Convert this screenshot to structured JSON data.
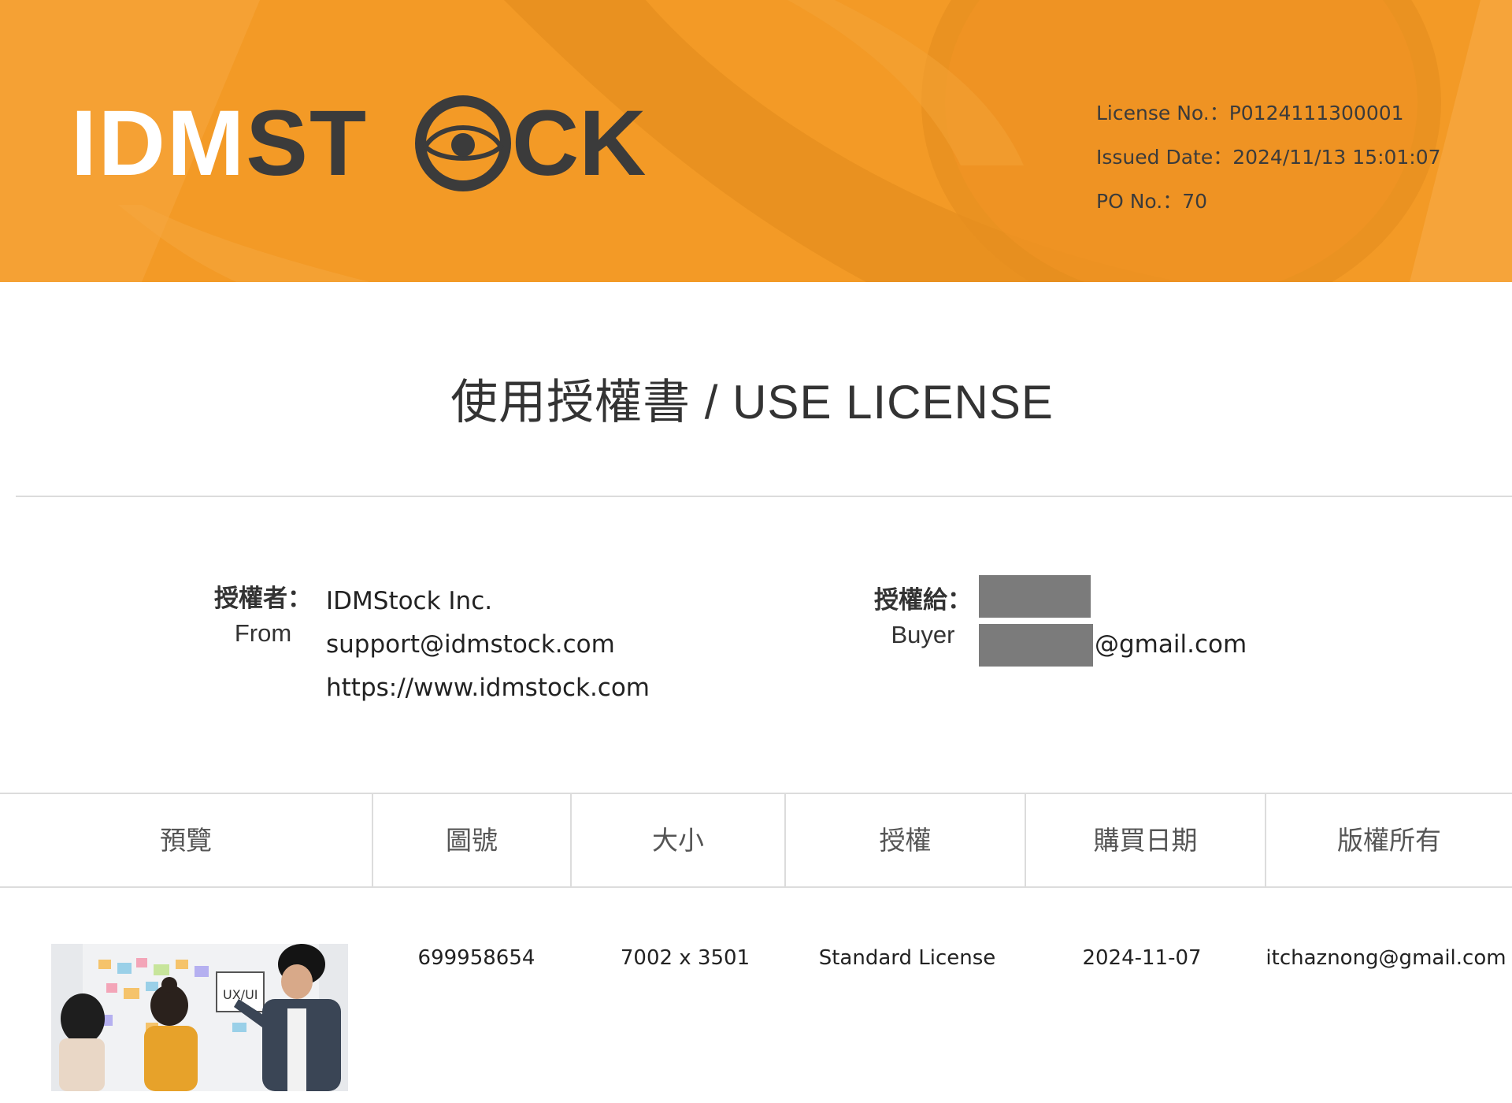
{
  "brand": {
    "logo_text": "IDMSTOCK",
    "colors": {
      "primary": "#f39a26",
      "dark": "#3b3b3b"
    }
  },
  "license_meta": {
    "license_no": "License No.：P0124111300001",
    "issued_date": "Issued Date：2024/11/13 15:01:07",
    "po_no": "PO No.：70"
  },
  "title": "使用授權書 / USE LICENSE",
  "from": {
    "label_zh": "授權者：",
    "label_en": "From",
    "company": "IDMStock Inc.",
    "email": "support@idmstock.com",
    "website": "https://www.idmstock.com"
  },
  "buyer": {
    "label_zh": "授權給：",
    "label_en": "Buyer",
    "email_suffix": "@gmail.com"
  },
  "table": {
    "headers": [
      "預覽",
      "圖號",
      "大小",
      "授權",
      "購買日期",
      "版權所有"
    ],
    "rows": [
      {
        "preview_icon": "photo-thumbnail",
        "image_id": "699958654",
        "size": "7002 x 3501",
        "license": "Standard License",
        "purchase_date": "2024-11-07",
        "copyright": "itchaznong@gmail.com"
      }
    ]
  }
}
